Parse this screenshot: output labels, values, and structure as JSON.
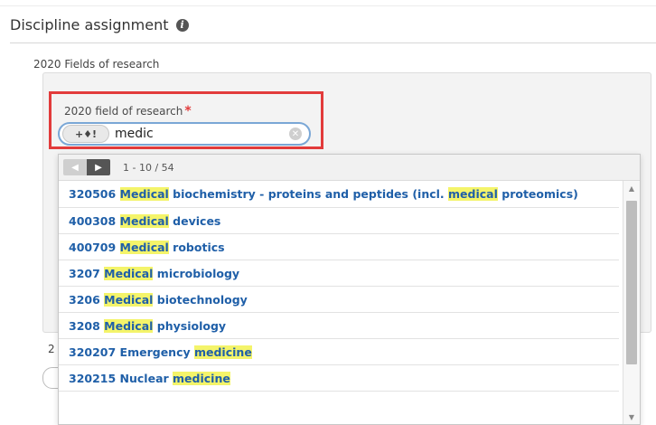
{
  "section": {
    "title": "Discipline assignment",
    "info_icon": "info-icon"
  },
  "subsection": {
    "label": "2020 Fields of research",
    "below_label": "2"
  },
  "field": {
    "label": "2020 field of research",
    "required_mark": "*",
    "mode_button_icons": "+♦!",
    "search_value": "medic",
    "clear_icon": "⊗"
  },
  "pager": {
    "prev_icon": "◀",
    "next_icon": "▶",
    "range": "1 - 10 / 54"
  },
  "results": [
    {
      "parts": [
        {
          "t": "320506 "
        },
        {
          "t": "Medical",
          "h": true
        },
        {
          "t": " biochemistry - proteins and peptides (incl. "
        },
        {
          "t": "medical",
          "h": true
        },
        {
          "t": " proteomics)"
        }
      ]
    },
    {
      "parts": [
        {
          "t": "400308 "
        },
        {
          "t": "Medical",
          "h": true
        },
        {
          "t": " devices"
        }
      ]
    },
    {
      "parts": [
        {
          "t": "400709 "
        },
        {
          "t": "Medical",
          "h": true
        },
        {
          "t": " robotics"
        }
      ]
    },
    {
      "parts": [
        {
          "t": "3207 "
        },
        {
          "t": "Medical",
          "h": true
        },
        {
          "t": " microbiology"
        }
      ]
    },
    {
      "parts": [
        {
          "t": "3206 "
        },
        {
          "t": "Medical",
          "h": true
        },
        {
          "t": " biotechnology"
        }
      ]
    },
    {
      "parts": [
        {
          "t": "3208 "
        },
        {
          "t": "Medical",
          "h": true
        },
        {
          "t": " physiology"
        }
      ]
    },
    {
      "parts": [
        {
          "t": "320207 Emergency "
        },
        {
          "t": "medicine",
          "h": true
        }
      ]
    },
    {
      "parts": [
        {
          "t": "320215 Nuclear "
        },
        {
          "t": "medicine",
          "h": true
        }
      ]
    }
  ],
  "colors": {
    "highlight_border": "#e23b3b",
    "link": "#1f5fa8",
    "match_highlight": "#f4f46a"
  }
}
